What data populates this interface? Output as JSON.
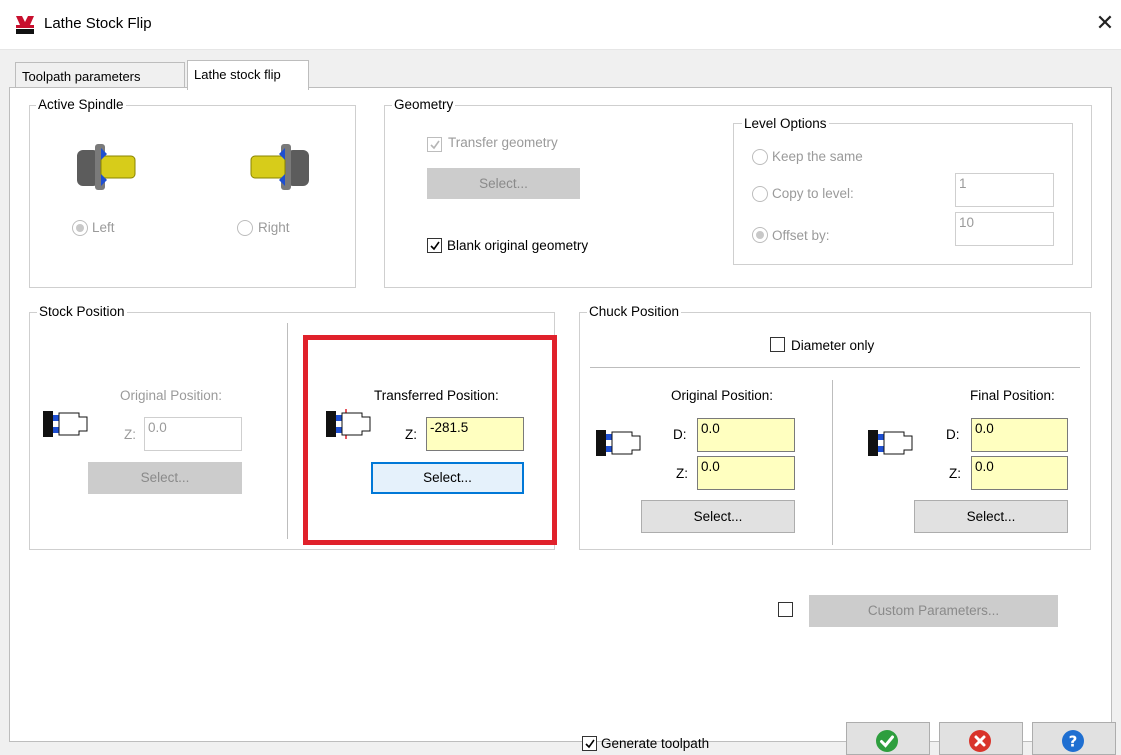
{
  "window": {
    "title": "Lathe Stock Flip",
    "close_glyph": "✕",
    "logo_icon": "mastercam-2023-logo-icon"
  },
  "tabs": [
    {
      "label": "Toolpath parameters",
      "active": false
    },
    {
      "label": "Lathe stock flip",
      "active": true
    }
  ],
  "active_spindle": {
    "label": "Active Spindle",
    "left": {
      "label": "Left",
      "selected": true,
      "icon": "spindle-left-icon"
    },
    "right": {
      "label": "Right",
      "selected": false,
      "icon": "spindle-right-icon"
    }
  },
  "geometry": {
    "label": "Geometry",
    "transfer_geometry": {
      "label": "Transfer geometry",
      "checked": true,
      "enabled": false
    },
    "select_label": "Select...",
    "blank_original": {
      "label": "Blank original geometry",
      "checked": true
    }
  },
  "level_options": {
    "label": "Level Options",
    "keep_same": "Keep the same",
    "copy_to_level": {
      "label": "Copy to level:",
      "value": "1"
    },
    "offset_by": {
      "label": "Offset by:",
      "value": "10",
      "selected": true
    }
  },
  "stock_position": {
    "label": "Stock Position",
    "original": {
      "label": "Original Position:",
      "z_label": "Z:",
      "z_value": "0.0",
      "select_label": "Select...",
      "enabled": false
    },
    "transferred": {
      "label": "Transferred Position:",
      "z_label": "Z:",
      "z_value": "-281.5",
      "select_label": "Select..."
    }
  },
  "chuck_position": {
    "label": "Chuck Position",
    "diameter_only": {
      "label": "Diameter only",
      "checked": false
    },
    "original": {
      "label": "Original Position:",
      "d_label": "D:",
      "d_value": "0.0",
      "z_label": "Z:",
      "z_value": "0.0",
      "select_label": "Select..."
    },
    "final": {
      "label": "Final Position:",
      "d_label": "D:",
      "d_value": "0.0",
      "z_label": "Z:",
      "z_value": "0.0",
      "select_label": "Select..."
    }
  },
  "custom_parameters": {
    "label": "Custom Parameters...",
    "checked": false
  },
  "footer": {
    "generate_toolpath": {
      "label": "Generate toolpath",
      "checked": true
    },
    "ok_icon": "ok-check-icon",
    "cancel_icon": "cancel-x-icon",
    "help_icon": "help-question-icon"
  },
  "colors": {
    "accent_green": "#2e9e3e",
    "cancel_red": "#d9342b",
    "help_blue": "#1f6fd1",
    "input_yellow": "#ffffc0",
    "highlight_red": "#e0212b"
  }
}
